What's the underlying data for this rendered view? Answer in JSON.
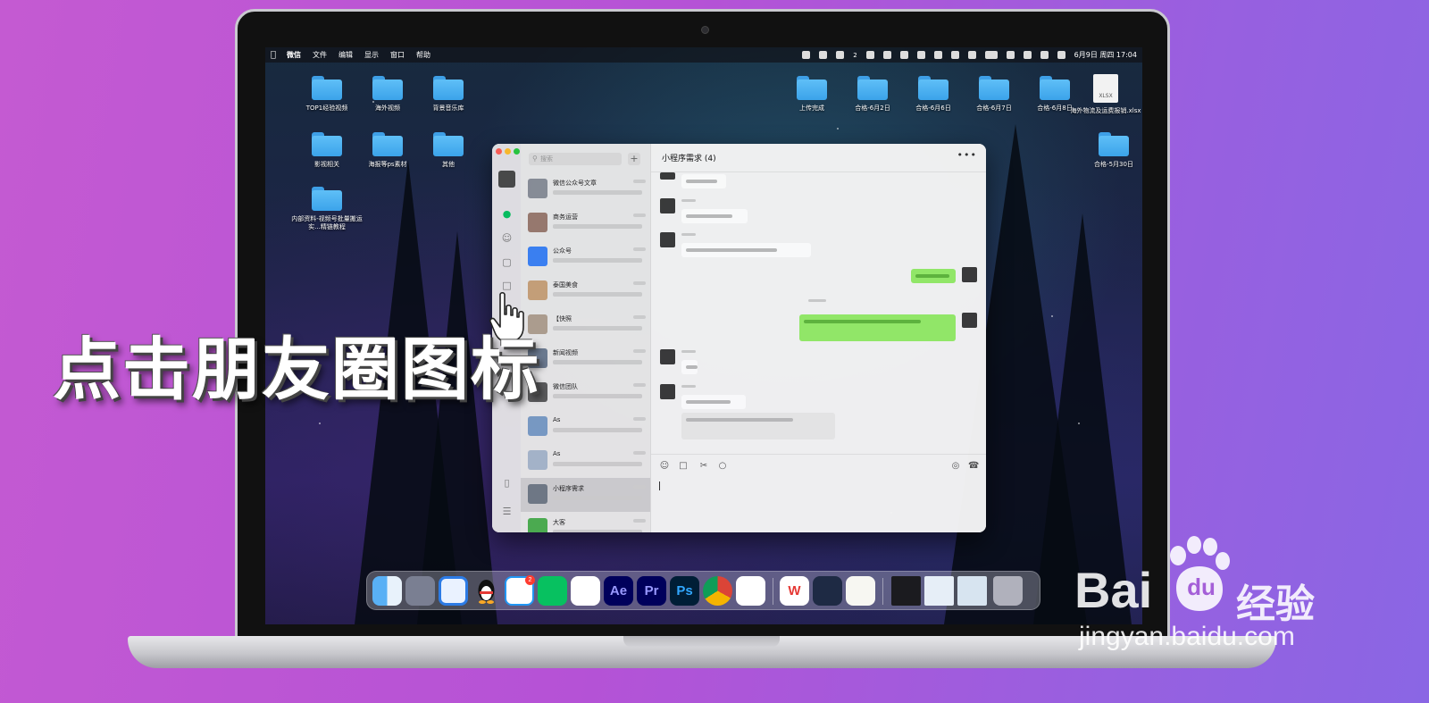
{
  "caption": "点击朋友圈图标",
  "watermark": {
    "brand": "Bai",
    "brand_paw_text": "du",
    "product": "经验",
    "url": "jingyan.baidu.com"
  },
  "menubar": {
    "app_name": "微信",
    "menus": [
      "文件",
      "编辑",
      "显示",
      "窗口",
      "帮助"
    ],
    "datetime": "6月9日 周四 17:04",
    "badge_count": "2"
  },
  "desktop_icons_left": [
    {
      "label": "TOP1经验视频",
      "type": "folder"
    },
    {
      "label": "海外视频",
      "type": "folder"
    },
    {
      "label": "背景音乐库",
      "type": "folder"
    },
    {
      "label": "影视相关",
      "type": "folder"
    },
    {
      "label": "海报等ps素材",
      "type": "folder"
    },
    {
      "label": "其他",
      "type": "folder"
    },
    {
      "label": "内部资料-视频号批量搬运实...精链教程",
      "type": "folder"
    }
  ],
  "desktop_icons_right": [
    {
      "label": "上传完成",
      "type": "folder"
    },
    {
      "label": "合格-6月2日",
      "type": "folder"
    },
    {
      "label": "合格-6月6日",
      "type": "folder"
    },
    {
      "label": "合格-6月7日",
      "type": "folder"
    },
    {
      "label": "合格-6月8日",
      "type": "folder"
    },
    {
      "label": "海外物流及运费报销.xlsx",
      "type": "xlsx"
    },
    {
      "label": "合格-5月30日",
      "type": "folder"
    }
  ],
  "wechat": {
    "search_placeholder": "搜索",
    "chat_title": "小程序需求 (4)",
    "conversations": [
      {
        "title": "微信公众号文章"
      },
      {
        "title": "商务运营"
      },
      {
        "title": "公众号"
      },
      {
        "title": "泰国美食"
      },
      {
        "title": "【快照"
      },
      {
        "title": "新闻视频"
      },
      {
        "title": "微信团队"
      },
      {
        "title": "As"
      },
      {
        "title": "As"
      },
      {
        "title": "小程序需求"
      },
      {
        "title": "大客"
      }
    ]
  },
  "dock": {
    "apps": [
      {
        "name": "finder",
        "label": ""
      },
      {
        "name": "launchpad",
        "label": ""
      },
      {
        "name": "safari",
        "label": ""
      },
      {
        "name": "qq",
        "label": ""
      },
      {
        "name": "messages",
        "label": ""
      },
      {
        "name": "wechat",
        "label": ""
      },
      {
        "name": "lark",
        "label": ""
      },
      {
        "name": "after-effects",
        "label": "Ae"
      },
      {
        "name": "premiere",
        "label": "Pr"
      },
      {
        "name": "photoshop",
        "label": "Ps"
      },
      {
        "name": "chrome",
        "label": ""
      },
      {
        "name": "baidu-netdisk",
        "label": ""
      },
      {
        "name": "wps",
        "label": "W"
      },
      {
        "name": "video-player",
        "label": ""
      },
      {
        "name": "notes",
        "label": ""
      },
      {
        "name": "recent-1",
        "label": ""
      },
      {
        "name": "recent-2",
        "label": ""
      },
      {
        "name": "recent-3",
        "label": ""
      },
      {
        "name": "trash",
        "label": ""
      }
    ]
  }
}
